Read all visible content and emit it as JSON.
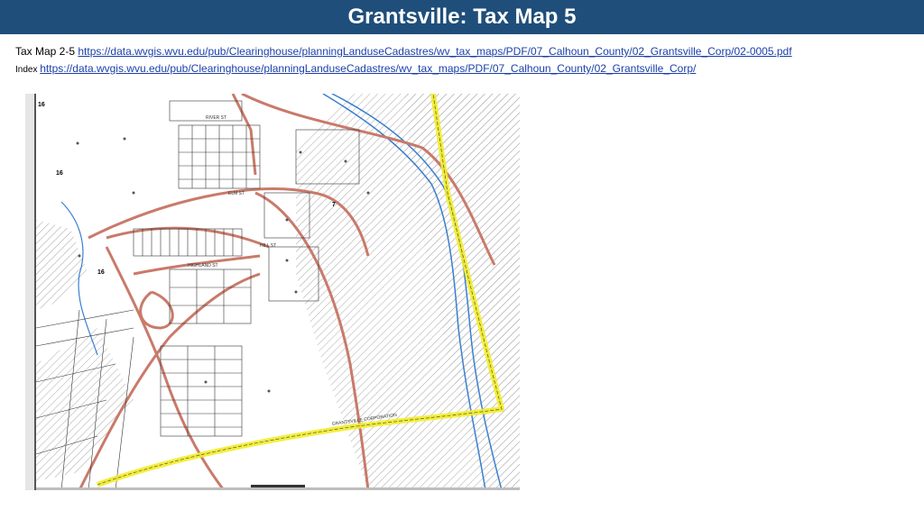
{
  "header": {
    "title": "Grantsville: Tax Map 5"
  },
  "links": {
    "map_label": "Tax Map 2-5",
    "map_url": "https://data.wvgis.wvu.edu/pub/Clearinghouse/planningLanduseCadastres/wv_tax_maps/PDF/07_Calhoun_County/02_Grantsville_Corp/02-0005.pdf",
    "index_label": "Index",
    "index_url": "https://data.wvgis.wvu.edu/pub/Clearinghouse/planningLanduseCadastres/wv_tax_maps/PDF/07_Calhoun_County/02_Grantsville_Corp/"
  },
  "map": {
    "sheet_numbers": [
      "16",
      "16",
      "16",
      "7"
    ],
    "street_labels": [
      "ELM ST",
      "HIGHLAND ST",
      "HILL ST",
      "RIVER ST"
    ],
    "boundary_label": "GRANTSVILLE CORPORATION",
    "colors": {
      "road": "#c97a6a",
      "river": "#3a7fd0",
      "boundary": "#f2ec2a",
      "hatch": "#9a9a9a"
    }
  }
}
